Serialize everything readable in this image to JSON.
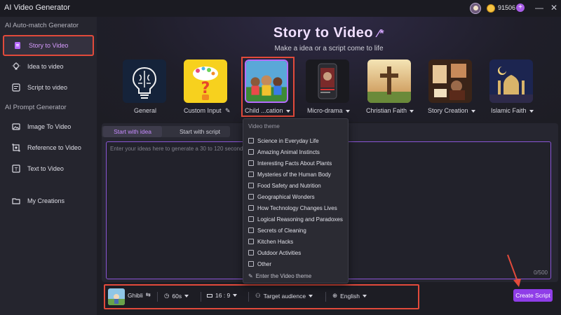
{
  "app": {
    "title": "AI Video Generator",
    "credits": "91506",
    "plus": "+",
    "minimize": "—",
    "close": "✕"
  },
  "sidebar": {
    "section1": "AI Auto-match Generator",
    "section2": "AI Prompt Generator",
    "items": [
      {
        "label": "Story to Video",
        "icon": "document-icon"
      },
      {
        "label": "Idea to video",
        "icon": "lightbulb-icon"
      },
      {
        "label": "Script to video",
        "icon": "script-icon"
      },
      {
        "label": "Image To Video",
        "icon": "image-icon"
      },
      {
        "label": "Reference to Video",
        "icon": "reference-icon"
      },
      {
        "label": "Text to Video",
        "icon": "text-icon"
      },
      {
        "label": "My Creations",
        "icon": "folder-icon"
      }
    ]
  },
  "hero": {
    "title": "Story to Video",
    "subtitle": "Make a idea or a script come to life"
  },
  "templates": [
    {
      "label": "General"
    },
    {
      "label": "Custom Input"
    },
    {
      "label": "Child ...cation"
    },
    {
      "label": "Micro-drama"
    },
    {
      "label": "Christian Faith"
    },
    {
      "label": "Story Creation"
    },
    {
      "label": "Islamic Faith"
    }
  ],
  "tabs": {
    "idea": "Start with idea",
    "script": "Start with script"
  },
  "editor": {
    "placeholder": "Enter your ideas here to generate a 30 to 120 seconds",
    "counter": "0/500"
  },
  "dropdown": {
    "title": "Video theme",
    "items": [
      "Science in Everyday Life",
      "Amazing Animal Instincts",
      "Interesting Facts About Plants",
      "Mysteries of the Human Body",
      "Food Safety and Nutrition",
      "Geographical Wonders",
      "How Technology Changes Lives",
      "Logical Reasoning and Paradoxes",
      "Secrets of Cleaning",
      "Kitchen Hacks",
      "Outdoor Activities",
      "Other"
    ],
    "enter": "Enter the Video theme"
  },
  "toolbar": {
    "style": "Ghibli",
    "duration": "60s",
    "ratio": "16 : 9",
    "audience": "Target audience",
    "language": "English",
    "create": "Create Script"
  },
  "colors": {
    "accent": "#8f3de8",
    "highlight": "#e24a3b"
  }
}
